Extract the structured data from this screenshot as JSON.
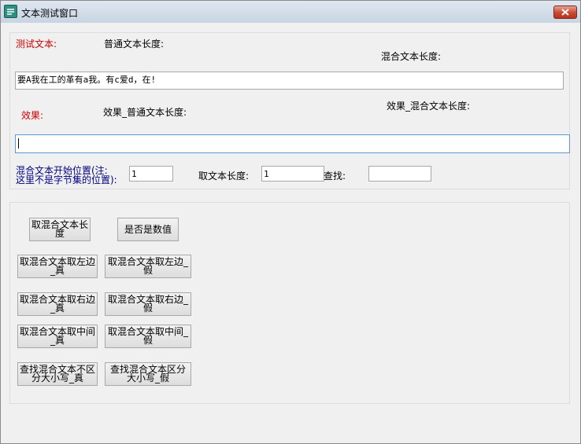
{
  "window": {
    "title": "文本测试窗口"
  },
  "labels": {
    "test_text": "测试文本:",
    "normal_len": "普通文本长度:",
    "mixed_len": "混合文本长度:",
    "effect": "效果:",
    "effect_normal_len": "效果_普通文本长度:",
    "effect_mixed_len": "效果_混合文本长度:",
    "start_pos_1": "混合文本开始位置(注:",
    "start_pos_2": "这里不是字节集的位置):",
    "take_len": "取文本长度:",
    "find": "查找:"
  },
  "inputs": {
    "test_text_value": "要A我在工的革有a我。有c爱d，在!",
    "effect_value": "",
    "start_pos_value": "1",
    "take_len_value": "1",
    "find_value": ""
  },
  "buttons": {
    "mixed_len": "取混合文本长度",
    "is_numeric": "是否是数值",
    "left_true": "取混合文本取左边_真",
    "left_false": "取混合文本取左边_假",
    "right_true": "取混合文本取右边_真",
    "right_false": "取混合文本取右边_假",
    "mid_true": "取混合文本取中间_真",
    "mid_false": "取混合文本取中间_假",
    "find_ci_true": "查找混合文本不区分大小写_真",
    "find_cs_false": "查找混合文本区分大小写_假"
  },
  "icons": {
    "app": "app-icon",
    "close": "close-icon"
  }
}
